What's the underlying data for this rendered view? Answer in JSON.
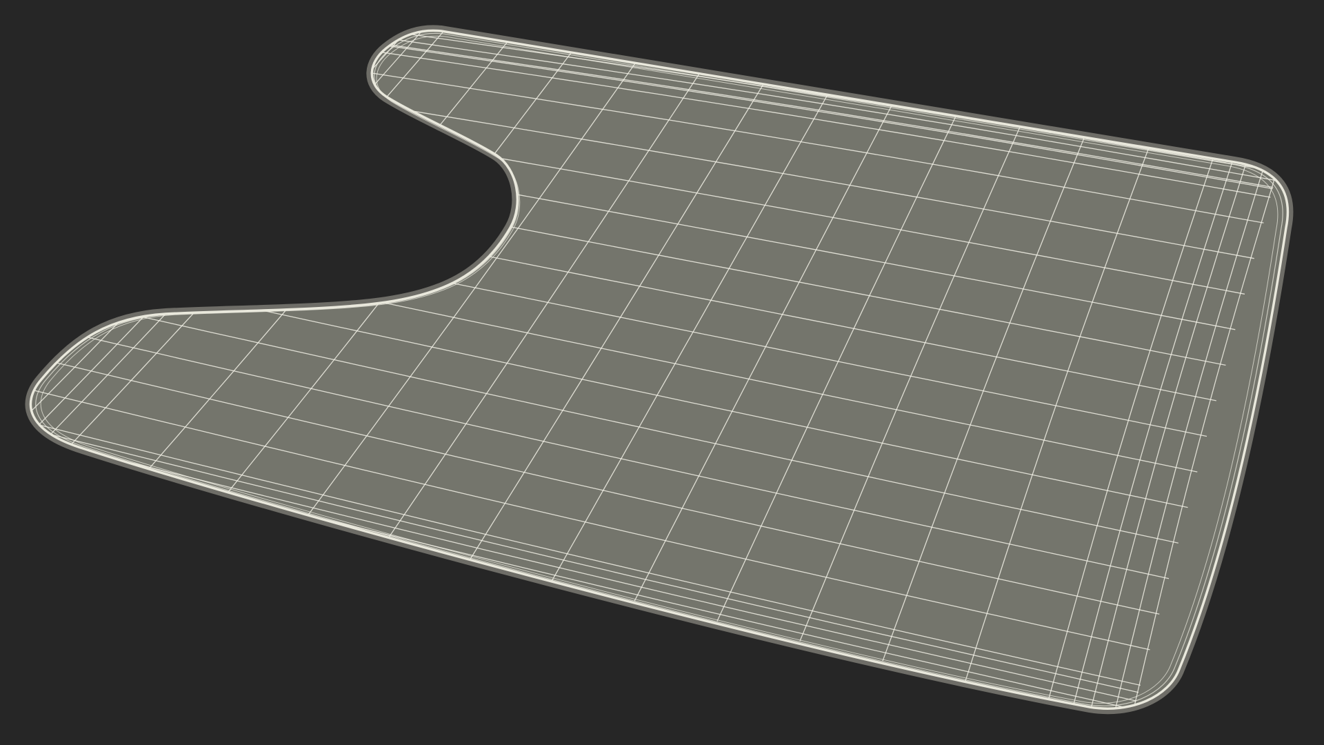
{
  "scene": {
    "subject": "contour-toilet-mat-wireframe",
    "background_color": "#262626",
    "surface_color": "#74756C",
    "wire_color": "#F2F1E6",
    "rim_color": "#E9E8DC",
    "rim_shadow_color": "#A9A89C"
  }
}
